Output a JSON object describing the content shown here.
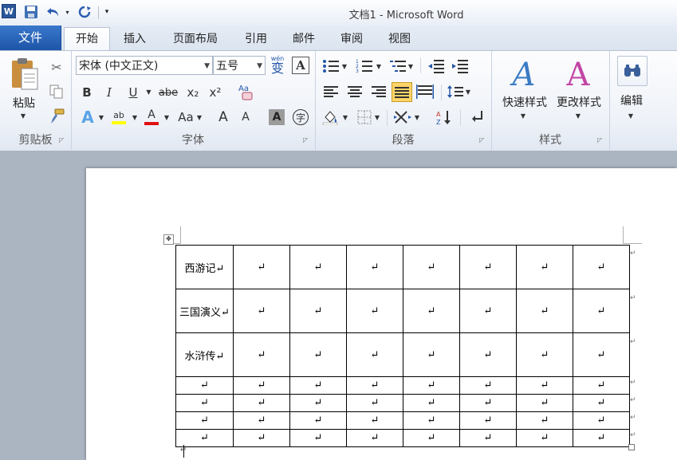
{
  "title": "文档1  -  Microsoft Word",
  "quick_access": {
    "app_icon": "W"
  },
  "tabs": [
    {
      "label": "文件"
    },
    {
      "label": "开始"
    },
    {
      "label": "插入"
    },
    {
      "label": "页面布局"
    },
    {
      "label": "引用"
    },
    {
      "label": "邮件"
    },
    {
      "label": "审阅"
    },
    {
      "label": "视图"
    }
  ],
  "ribbon": {
    "clipboard": {
      "label": "剪贴板",
      "paste_label": "粘贴"
    },
    "font": {
      "label": "字体",
      "font_name": "宋体 (中文正文)",
      "font_size": "五号",
      "bold": "B",
      "italic": "I",
      "underline": "U",
      "strike": "abe",
      "sub": "x₂",
      "sup": "x²",
      "effect": "A",
      "highlight": "ab",
      "color": "A",
      "case": "Aa",
      "grow": "A",
      "shrink": "A",
      "shade": "A",
      "enclose": "字",
      "char_border": "A",
      "phonetic": "wén",
      "phonetic_char": "变"
    },
    "paragraph": {
      "label": "段落"
    },
    "styles": {
      "label": "样式",
      "quick_style": "快速样式",
      "change_style": "更改样式",
      "style_glyph": "A"
    },
    "editing": {
      "label": "编辑"
    }
  },
  "document": {
    "table": {
      "rows": [
        [
          "西游记↵",
          "↵",
          "↵",
          "↵",
          "↵",
          "↵",
          "↵",
          "↵"
        ],
        [
          "三国演义↵",
          "↵",
          "↵",
          "↵",
          "↵",
          "↵",
          "↵",
          "↵"
        ],
        [
          "水浒传↵",
          "↵",
          "↵",
          "↵",
          "↵",
          "↵",
          "↵",
          "↵"
        ],
        [
          "↵",
          "↵",
          "↵",
          "↵",
          "↵",
          "↵",
          "↵",
          "↵"
        ],
        [
          "↵",
          "↵",
          "↵",
          "↵",
          "↵",
          "↵",
          "↵",
          "↵"
        ],
        [
          "↵",
          "↵",
          "↵",
          "↵",
          "↵",
          "↵",
          "↵",
          "↵"
        ],
        [
          "↵",
          "↵",
          "↵",
          "↵",
          "↵",
          "↵",
          "↵",
          "↵"
        ]
      ],
      "row_end_mark": "↵"
    },
    "paragraph_mark": "↵"
  },
  "colors": {
    "file_tab": "#2a67bd",
    "ribbon_bg": "#eef2f8",
    "doc_bg": "#abb4c1",
    "active_align": "#ffd466"
  }
}
